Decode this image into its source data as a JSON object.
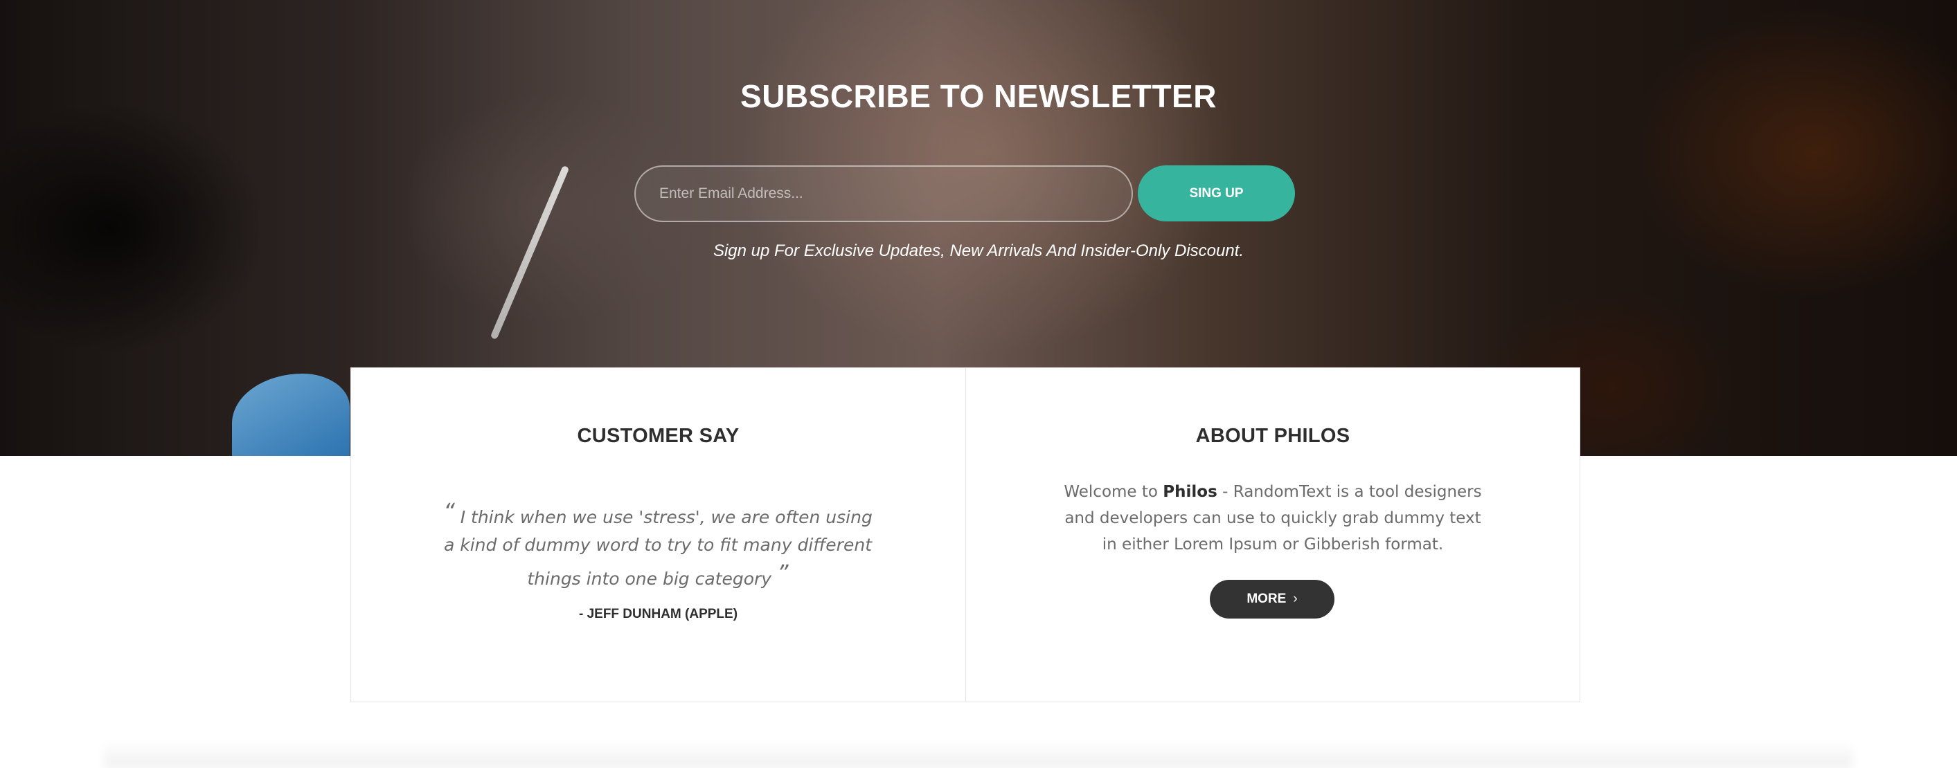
{
  "newsletter": {
    "title": "SUBSCRIBE TO NEWSLETTER",
    "email_placeholder": "Enter Email Address...",
    "signup_label": "SING UP",
    "subtitle": "Sign up For Exclusive Updates, New Arrivals And Insider-Only Discount."
  },
  "customer": {
    "title": "CUSTOMER SAY",
    "quote_open": "“",
    "quote": "I think when we use 'stress', we are often using a kind of dummy word to try to fit many different things into one big category",
    "quote_close": "”",
    "author": "- JEFF DUNHAM (APPLE)"
  },
  "about": {
    "title": "ABOUT PHILOS",
    "text_before": "Welcome to ",
    "brand": "Philos",
    "text_after": " - RandomText is a tool designers and developers can use to quickly grab dummy text in either Lorem Ipsum or Gibberish format.",
    "more_label": "MORE",
    "more_icon": "›"
  },
  "colors": {
    "accent": "#37b49d",
    "dark_button": "#333333"
  }
}
